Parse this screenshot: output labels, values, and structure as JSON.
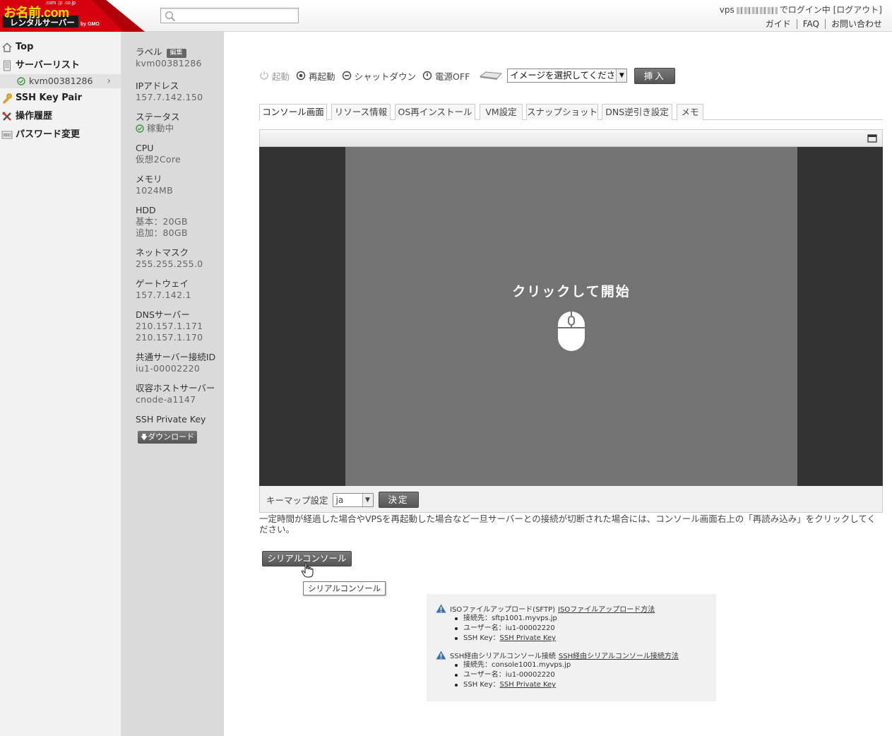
{
  "header": {
    "logo_main": "お名前.com",
    "logo_sub": "レンタルサーバー",
    "logo_domains": ".com .jp .co.jp",
    "logo_by": "by GMO",
    "search_placeholder": "",
    "user_prefix": "vps",
    "login_status": "でログイン中",
    "logout_label": "[ログアウト]",
    "links": [
      "ガイド",
      "FAQ",
      "お問い合わせ"
    ]
  },
  "sidebar": {
    "items": [
      {
        "label": "Top",
        "icon": "home-icon"
      },
      {
        "label": "サーバーリスト",
        "icon": "server-list-icon"
      },
      {
        "label": "kvm00381286",
        "icon": "status-ok-icon"
      },
      {
        "label": "SSH Key Pair",
        "icon": "key-icon"
      },
      {
        "label": "操作履歴",
        "icon": "tools-icon"
      },
      {
        "label": "パスワード変更",
        "icon": "password-icon"
      }
    ]
  },
  "server_info": {
    "label_title": "ラベル",
    "edit_label": "編集",
    "label_value": "kvm00381286",
    "ip_title": "IPアドレス",
    "ip_value": "157.7.142.150",
    "status_title": "ステータス",
    "status_value": "稼動中",
    "cpu_title": "CPU",
    "cpu_value": "仮想2Core",
    "memory_title": "メモリ",
    "memory_value": "1024MB",
    "hdd_title": "HDD",
    "hdd_base": "基本：20GB",
    "hdd_add": "追加：80GB",
    "netmask_title": "ネットマスク",
    "netmask_value": "255.255.255.0",
    "gateway_title": "ゲートウェイ",
    "gateway_value": "157.7.142.1",
    "dns_title": "DNSサーバー",
    "dns_values": [
      "210.157.1.171",
      "210.157.1.170"
    ],
    "shared_id_title": "共通サーバー接続ID",
    "shared_id_value": "iu1-00002220",
    "host_title": "収容ホストサーバー",
    "host_value": "cnode-a1147",
    "ssh_key_title": "SSH Private Key",
    "download_label": "ダウンロード"
  },
  "power": {
    "start": "起動",
    "restart": "再起動",
    "shutdown": "シャットダウン",
    "power_off": "電源OFF",
    "image_select": "イメージを選択してください",
    "insert": "挿入"
  },
  "tabs": [
    "コンソール画面",
    "リソース情報",
    "OS再インストール",
    "VM設定",
    "スナップショット",
    "DNS逆引き設定",
    "メモ"
  ],
  "console": {
    "click_to_start": "クリックして開始",
    "keymap_label": "キーマップ設定",
    "keymap_value": "ja",
    "decide": "決定",
    "note": "一定時間が経過した場合やVPSを再起動した場合など一旦サーバーとの接続が切断された場合には、コンソール画面右上の「再読み込み」をクリックしてください。",
    "serial_button": "シリアルコンソール",
    "tooltip": "シリアルコンソール"
  },
  "info_box": {
    "iso_title": "ISOファイルアップロード(SFTP)",
    "iso_link": "ISOファイルアップロード方法",
    "iso_items": [
      "接続先：sftp1001.myvps.jp",
      "ユーザー名：iu1-00002220"
    ],
    "iso_ssh_key_prefix": "SSH Key：",
    "iso_ssh_key_link": "SSH Private Key",
    "serial_title": "SSH経由シリアルコンソール接続",
    "serial_link": "SSH経由シリアルコンソール接続方法",
    "serial_items": [
      "接続先：console1001.myvps.jp",
      "ユーザー名：iu1-00002220"
    ],
    "serial_ssh_key_prefix": "SSH Key：",
    "serial_ssh_key_link": "SSH Private Key"
  },
  "colors": {
    "brand_red": "#d7000f",
    "logo_yellow": "#ffe000",
    "status_green": "#3a9a3a",
    "button_dark": "#5a5a5a"
  }
}
